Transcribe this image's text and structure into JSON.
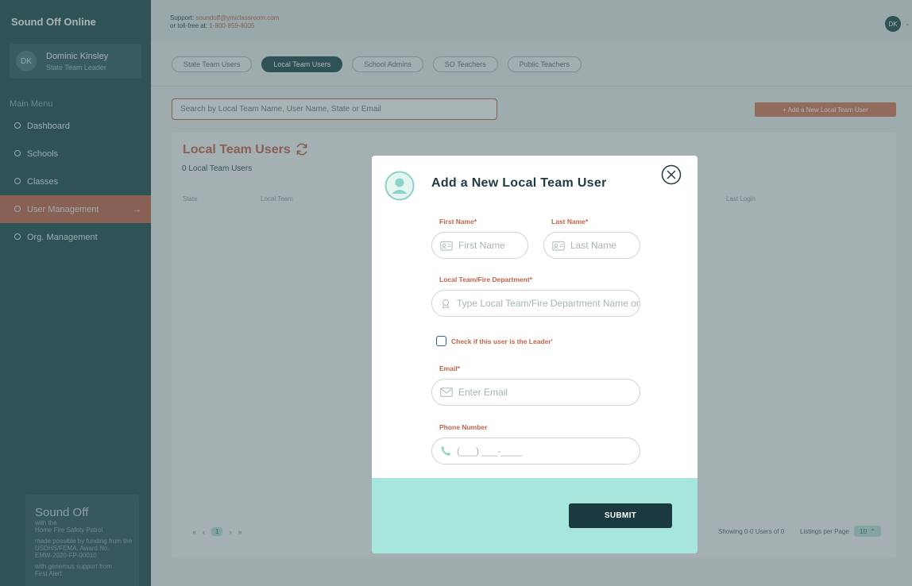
{
  "sidebar": {
    "brand": "Sound Off Online",
    "user": {
      "initials": "DK",
      "name": "Dominic Kinsley",
      "role": "State Team Leader"
    },
    "menu_heading": "Main Menu",
    "items": [
      {
        "label": "Dashboard"
      },
      {
        "label": "Schools"
      },
      {
        "label": "Classes"
      },
      {
        "label": "User Management",
        "active": true
      },
      {
        "label": "Org. Management"
      }
    ],
    "footer": {
      "title": "Sound Off",
      "line1": "with the",
      "line2": "Home Fire Safety Patrol",
      "funding1": "made possible by funding from the",
      "funding2": "USDHS/FEMA, Award No.",
      "funding3": "EMW-2020-FP-00010",
      "support1": "with generous support from",
      "support2": "First Alert"
    }
  },
  "topbar": {
    "support_prefix": "Support:",
    "support_email": "soundoff@ymiclassroom.com",
    "tollfree_prefix": "or toll-free at:",
    "tollfree_number": "1-800-859-8005",
    "avatar_initials": "DK"
  },
  "tabs": [
    {
      "label": "State Team Users"
    },
    {
      "label": "Local Team Users",
      "active": true
    },
    {
      "label": "School Admins"
    },
    {
      "label": "SO Teachers"
    },
    {
      "label": "Public Teachers"
    }
  ],
  "search": {
    "placeholder": "Search by Local Team Name, User Name, State or Email",
    "value": ""
  },
  "add_button": "+ Add a New Local Team User",
  "panel": {
    "title": "Local Team Users",
    "count": "0 Local Team Users",
    "columns": {
      "state": "State",
      "local_team": "Local Team",
      "last_login": "Last Login"
    },
    "pagination": {
      "first": "«",
      "prev": "‹",
      "page": "1",
      "next": "›",
      "last": "»"
    },
    "showing": "Showing 0-0 Users of 0",
    "listings_label": "Listings per Page",
    "per_page": "10"
  },
  "modal": {
    "title": "Add a New Local Team User",
    "first_name_label": "First Name*",
    "first_name_placeholder": "First Name",
    "last_name_label": "Last Name*",
    "last_name_placeholder": "Last Name",
    "team_label": "Local Team/Fire Department*",
    "team_placeholder": "Type Local Team/Fire Department Name or Zip",
    "leader_checkbox_label": "Check if this user is the Leader'",
    "email_label": "Email*",
    "email_placeholder": "Enter Email",
    "phone_label": "Phone Number",
    "phone_placeholder": "(___) ___-____",
    "submit_label": "SUBMIT"
  },
  "colors": {
    "sidebar": "#1b4a4f",
    "accent": "#c0644a",
    "modal_footer": "#a6e6dc",
    "submit": "#1b3a3f"
  }
}
